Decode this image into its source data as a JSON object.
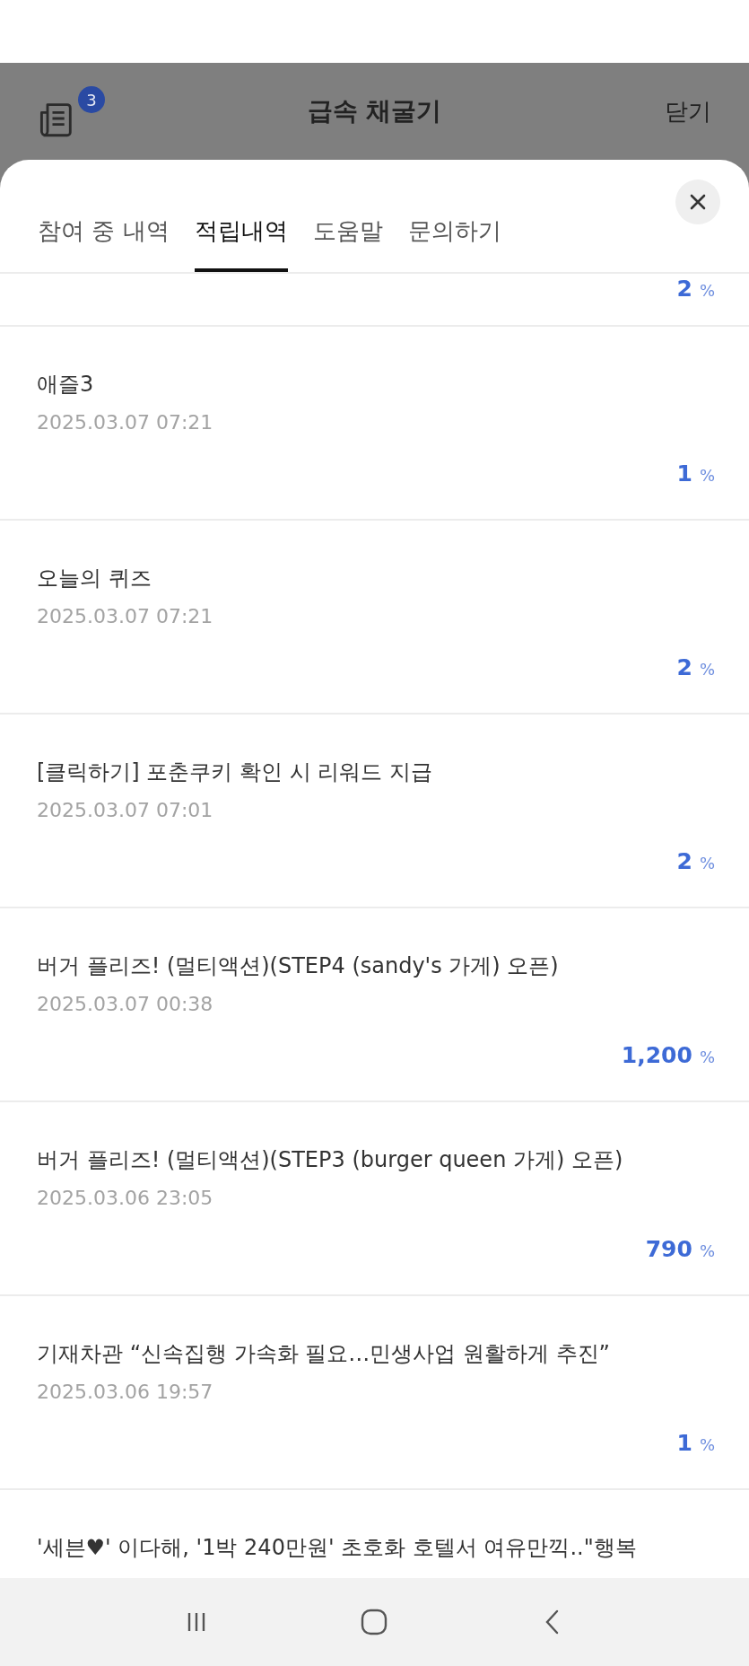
{
  "header": {
    "badge": "3",
    "title": "급속 채굴기",
    "close_label": "닫기"
  },
  "tabs": [
    {
      "label": "참여 중 내역",
      "selected": false
    },
    {
      "label": "적립내역",
      "selected": true
    },
    {
      "label": "도움말",
      "selected": false
    },
    {
      "label": "문의하기",
      "selected": false
    }
  ],
  "rows": [
    {
      "kind": "partial",
      "amount": "2",
      "unit": "%"
    },
    {
      "kind": "entry",
      "title": "애즐3",
      "date": "2025.03.07 07:21",
      "amount": "1",
      "unit": "%"
    },
    {
      "kind": "entry",
      "title": "오늘의 퀴즈",
      "date": "2025.03.07 07:21",
      "amount": "2",
      "unit": "%"
    },
    {
      "kind": "entry",
      "title": "[클릭하기] 포춘쿠키 확인 시 리워드 지급",
      "date": "2025.03.07 07:01",
      "amount": "2",
      "unit": "%"
    },
    {
      "kind": "entry",
      "title": "버거 플리즈! (멀티액션)(STEP4 (sandy's 가게) 오픈)",
      "date": "2025.03.07 00:38",
      "amount": "1,200",
      "unit": "%"
    },
    {
      "kind": "entry",
      "title": "버거 플리즈! (멀티액션)(STEP3 (burger queen 가게) 오픈)",
      "date": "2025.03.06 23:05",
      "amount": "790",
      "unit": "%"
    },
    {
      "kind": "entry",
      "title": "기재차관 “신속집행 가속화 필요…민생사업 원활하게 추진”",
      "date": "2025.03.06 19:57",
      "amount": "1",
      "unit": "%"
    },
    {
      "kind": "cut",
      "title": "'세븐♥' 이다해, '1박 240만원' 초호화 호텔서 여유만끽..\"행복"
    }
  ]
}
